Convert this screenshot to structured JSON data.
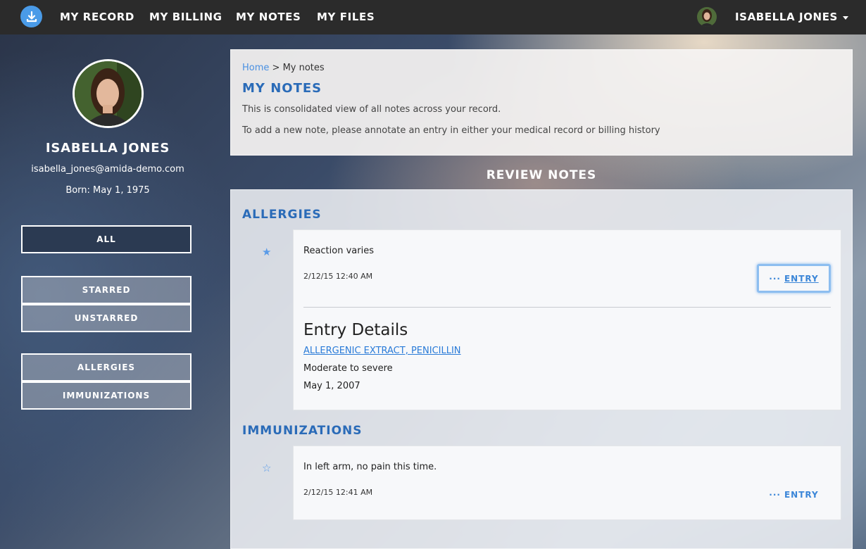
{
  "nav": {
    "links": [
      "MY RECORD",
      "MY BILLING",
      "MY NOTES",
      "MY FILES"
    ],
    "user_label": "ISABELLA JONES"
  },
  "profile": {
    "name": "ISABELLA JONES",
    "email": "isabella_jones@amida-demo.com",
    "born": "Born: May 1, 1975"
  },
  "sidebar": {
    "filter_all": "ALL",
    "starred": "STARRED",
    "unstarred": "UNSTARRED",
    "allergies": "ALLERGIES",
    "immunizations": "IMMUNIZATIONS"
  },
  "header": {
    "breadcrumb_home": "Home",
    "breadcrumb_sep": " > ",
    "breadcrumb_current": "My notes",
    "title": "MY NOTES",
    "desc1": "This is consolidated view of all notes across your record.",
    "desc2": "To add a new note, please annotate an entry in either your medical record or billing history"
  },
  "review_title": "REVIEW NOTES",
  "sections": [
    {
      "title": "ALLERGIES",
      "note": {
        "starred": true,
        "text": "Reaction varies",
        "date": "2/12/15 12:40 AM",
        "entry_label": "ENTRY",
        "details_title": "Entry Details",
        "details_link": "ALLERGENIC EXTRACT, PENICILLIN",
        "details_severity": "Moderate to severe",
        "details_date": "May 1, 2007"
      }
    },
    {
      "title": "IMMUNIZATIONS",
      "note": {
        "starred": false,
        "text": "In left arm, no pain this time.",
        "date": "2/12/15 12:41 AM",
        "entry_label": "ENTRY"
      }
    }
  ],
  "colors": {
    "accent": "#2a6bb8",
    "link": "#4a90e2",
    "navbar": "#2b2b2b"
  }
}
